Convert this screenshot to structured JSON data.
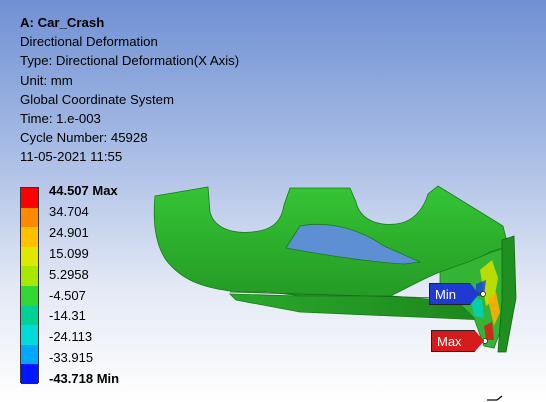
{
  "result": {
    "title": "A: Car_Crash",
    "result_name": "Directional Deformation",
    "type": "Type: Directional Deformation(X Axis)",
    "unit": "Unit: mm",
    "coordinate_system": "Global Coordinate System",
    "time": "Time: 1.e-003",
    "cycle": "Cycle Number: 45928",
    "timestamp": "11-05-2021 11:55"
  },
  "legend": {
    "labels": [
      "44.507 Max",
      "34.704",
      "24.901",
      "15.099",
      "5.2958",
      "-4.507",
      "-14.31",
      "-24.113",
      "-33.915",
      "-43.718 Min"
    ],
    "colors": [
      "#ff0000",
      "#ff8a00",
      "#ffc000",
      "#e0e800",
      "#a8e700",
      "#33d833",
      "#00d296",
      "#00dada",
      "#00a9ff",
      "#0018ff"
    ]
  },
  "probes": {
    "min_label": "Min",
    "max_label": "Max",
    "min_color": "#1f3ad0",
    "max_color": "#d61b1b"
  },
  "model": {
    "body_color": "#2db52d",
    "shadow_color": "#1f8f1f"
  }
}
